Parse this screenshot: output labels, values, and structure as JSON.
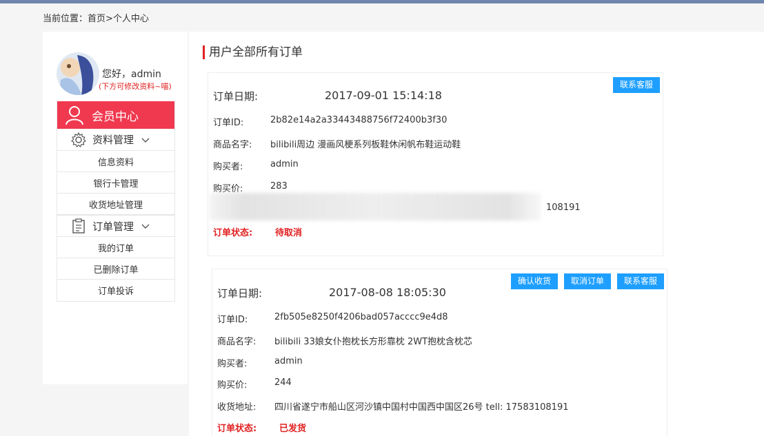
{
  "breadcrumb": "当前位置：首页>个人中心",
  "user": {
    "greeting": "您好，admin",
    "hint": "(下方可修改资料~喵)"
  },
  "menu": {
    "head": "会员中心",
    "profile_group": "资料管理",
    "profile_items": [
      "信息资料",
      "银行卡管理",
      "收货地址管理"
    ],
    "order_group": "订单管理",
    "order_items": [
      "我的订单",
      "已删除订单",
      "订单投诉"
    ]
  },
  "main": {
    "title": "用户全部所有订单",
    "labels": {
      "date": "订单日期:",
      "id": "订单ID:",
      "product": "商品名字:",
      "buyer": "购买者:",
      "price": "购买价:",
      "address": "收货地址:",
      "status": "订单状态:"
    },
    "orders": [
      {
        "date": "2017-09-01 15:14:18",
        "id": "2b82e14a2a33443488756f72400b3f30",
        "product": "bilibili周边 漫画风梗系列板鞋休闲帆布鞋运动鞋",
        "buyer": "admin",
        "price": "283",
        "address_visible": "108191",
        "status": "待取消",
        "buttons": [
          "联系客服"
        ]
      },
      {
        "date": "2017-08-08 18:05:30",
        "id": "2fb505e8250f4206bad057acccc9e4d8",
        "product": "bilibili 33娘女仆抱枕长方形靠枕 2WT抱枕含枕芯",
        "buyer": "admin",
        "price": "244",
        "address": "四川省遂宁市船山区河沙镇中国村中国西中国区26号 tell:  17583108191",
        "status": "已发货",
        "buttons": [
          "确认收货",
          "取消订单",
          "联系客服"
        ]
      }
    ]
  },
  "colors": {
    "accent_red": "#f0394f",
    "button_blue": "#1e9fff",
    "status_red": "#e02020"
  }
}
